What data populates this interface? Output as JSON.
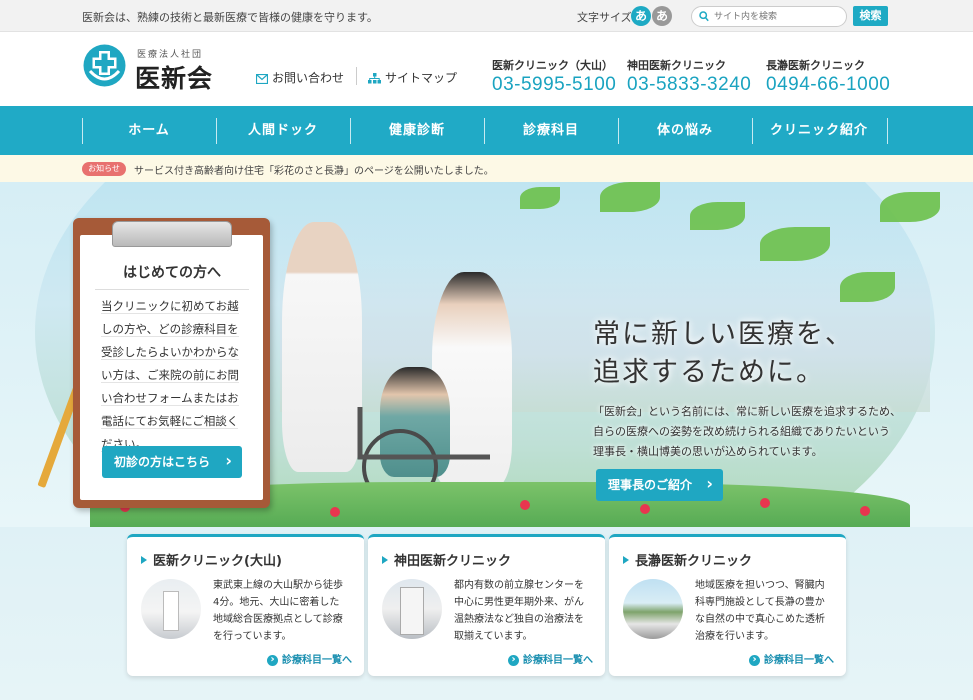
{
  "topbar": {
    "tagline": "医新会は、熟練の技術と最新医療で皆様の健康を守ります。",
    "fontsize_label": "文字サイズ",
    "fontsize_small": "あ",
    "fontsize_large": "あ",
    "search_placeholder": "サイト内を検索",
    "search_button": "検索"
  },
  "header": {
    "logo_sub": "医療法人社団",
    "logo_main": "医新会",
    "contact_label": "お問い合わせ",
    "sitemap_label": "サイトマップ",
    "clinics": [
      {
        "name": "医新クリニック（大山）",
        "phone": "03-5995-5100"
      },
      {
        "name": "神田医新クリニック",
        "phone": "03-5833-3240"
      },
      {
        "name": "長瀞医新クリニック",
        "phone": "0494-66-1000"
      }
    ]
  },
  "nav": {
    "items": [
      "ホーム",
      "人間ドック",
      "健康診断",
      "診療科目",
      "体の悩み",
      "クリニック紹介"
    ]
  },
  "notice": {
    "badge": "お知らせ",
    "text": "サービス付き高齢者向け住宅「彩花のさと長瀞」のページを公開いたしました。"
  },
  "intro": {
    "title": "はじめての方へ",
    "body_lines": [
      "当クリニックに初めてお越",
      "しの方や、どの診療科目を",
      "受診したらよいかわからな",
      "い方は、ご来院の前にお問",
      "い合わせフォームまたはお",
      "電話にてお気軽にご相談く",
      "ださい。"
    ],
    "button": "初診の方はこちら"
  },
  "hero": {
    "title_lines": [
      "常に新しい医療を、",
      "追求するために。"
    ],
    "text_lines": [
      "「医新会」という名前には、常に新しい医療を追求するため、",
      "自らの医療への姿勢を改め続けられる組織でありたいという",
      "理事長・横山博美の思いが込められています。"
    ],
    "button": "理事長のご紹介"
  },
  "cards": [
    {
      "title": "医新クリニック(大山)",
      "text_lines": [
        "東武東上線の大山駅から徒歩",
        "4分。地元、大山に密着した",
        "地域総合医療拠点として診療",
        "を行っています。"
      ],
      "link": "診療科目一覧へ"
    },
    {
      "title": "神田医新クリニック",
      "text_lines": [
        "都内有数の前立腺センターを",
        "中心に男性更年期外来、がん",
        "温熱療法など独自の治療法を",
        "取揃えています。"
      ],
      "link": "診療科目一覧へ"
    },
    {
      "title": "長瀞医新クリニック",
      "text_lines": [
        "地域医療を担いつつ、腎臓内",
        "科専門施設として長瀞の豊か",
        "な自然の中で真心こめた透析",
        "治療を行います。"
      ],
      "link": "診療科目一覧へ"
    }
  ],
  "colors": {
    "accent": "#20aac6",
    "phone": "#1aa3c0",
    "notice_badge": "#e8716f",
    "clipboard": "#a65a38"
  }
}
